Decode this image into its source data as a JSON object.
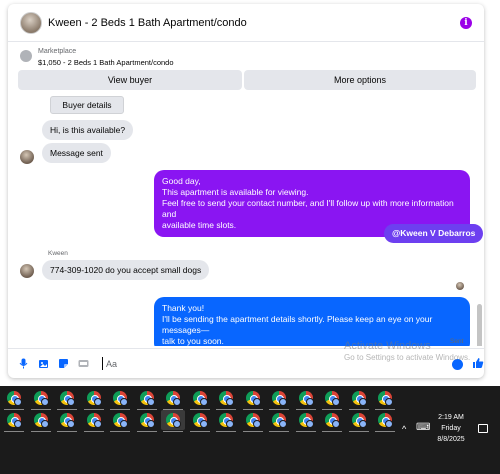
{
  "header": {
    "title": "Kween - 2 Beds 1 Bath Apartment/condo",
    "info_icon": "i"
  },
  "marketplace": {
    "label": "Marketplace",
    "listing": "$1,050 - 2 Beds 1 Bath Apartment/condo"
  },
  "actions": {
    "view_buyer": "View buyer",
    "more_options": "More options"
  },
  "messages": {
    "buyer_details": "Buyer details",
    "auto_msg": "Hi, is this available?",
    "message_sent": "Message sent",
    "seller_reply": [
      "Good day,",
      "This apartment is available for viewing.",
      "Feel free to send your contact number, and I'll follow up with more information and",
      "available time slots."
    ],
    "mention": "@Kween V Debarros",
    "sender_name": "Kween",
    "buyer_msg": "774-309-1020 do you accept small dogs",
    "seller_reply2": [
      "Thank you!",
      "I'll be sending the apartment details shortly. Please keep an eye on your messages—",
      "talk to you soon."
    ],
    "status": "Sent"
  },
  "composer": {
    "placeholder": "Aa"
  },
  "watermark": {
    "line1": "Activate Windows",
    "line2": "Go to Settings to activate Windows."
  },
  "taskbar": {
    "clock_time": "2:19 AM",
    "clock_day": "Friday",
    "clock_date": "8/8/2025",
    "tray_chevron": "^",
    "keyboard_icon": "⌨"
  },
  "colors": {
    "purple": "#8a15f2",
    "blue": "#0866ff",
    "mention_bg": "#6d3ff0"
  }
}
